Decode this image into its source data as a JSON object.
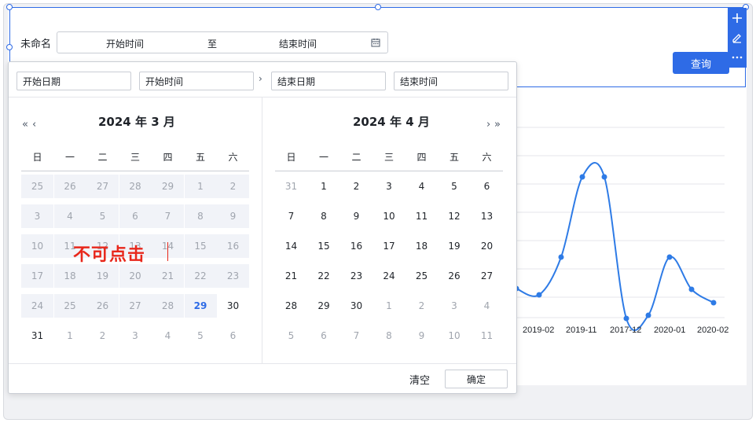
{
  "filter": {
    "label": "未命名",
    "start_placeholder": "开始时间",
    "to": "至",
    "end_placeholder": "结束时间",
    "query_label": "查询"
  },
  "picker": {
    "start_date_placeholder": "开始日期",
    "start_time_placeholder": "开始时间",
    "end_date_placeholder": "结束日期",
    "end_time_placeholder": "结束时间",
    "left_title": "2024 年 3 月",
    "right_title": "2024 年 4 月",
    "weekdays": [
      "日",
      "一",
      "二",
      "三",
      "四",
      "五",
      "六"
    ],
    "left_rows": [
      [
        "25",
        "26",
        "27",
        "28",
        "29",
        "1",
        "2"
      ],
      [
        "3",
        "4",
        "5",
        "6",
        "7",
        "8",
        "9"
      ],
      [
        "10",
        "11",
        "12",
        "13",
        "14",
        "15",
        "16"
      ],
      [
        "17",
        "18",
        "19",
        "20",
        "21",
        "22",
        "23"
      ],
      [
        "24",
        "25",
        "26",
        "27",
        "28",
        "29",
        "30"
      ],
      [
        "31",
        "1",
        "2",
        "3",
        "4",
        "5",
        "6"
      ]
    ],
    "right_rows": [
      [
        "31",
        "1",
        "2",
        "3",
        "4",
        "5",
        "6"
      ],
      [
        "7",
        "8",
        "9",
        "10",
        "11",
        "12",
        "13"
      ],
      [
        "14",
        "15",
        "16",
        "17",
        "18",
        "19",
        "20"
      ],
      [
        "21",
        "22",
        "23",
        "24",
        "25",
        "26",
        "27"
      ],
      [
        "28",
        "29",
        "30",
        "1",
        "2",
        "3",
        "4"
      ],
      [
        "5",
        "6",
        "7",
        "8",
        "9",
        "10",
        "11"
      ]
    ],
    "annotation": "不可点击",
    "clear_label": "清空",
    "ok_label": "确定"
  },
  "chart_data": {
    "type": "line",
    "categories": [
      "2019-02",
      "2019-11",
      "2017-12",
      "2020-01",
      "2020-02"
    ],
    "color": "#2e7be6",
    "smooth": true,
    "grid": true
  }
}
